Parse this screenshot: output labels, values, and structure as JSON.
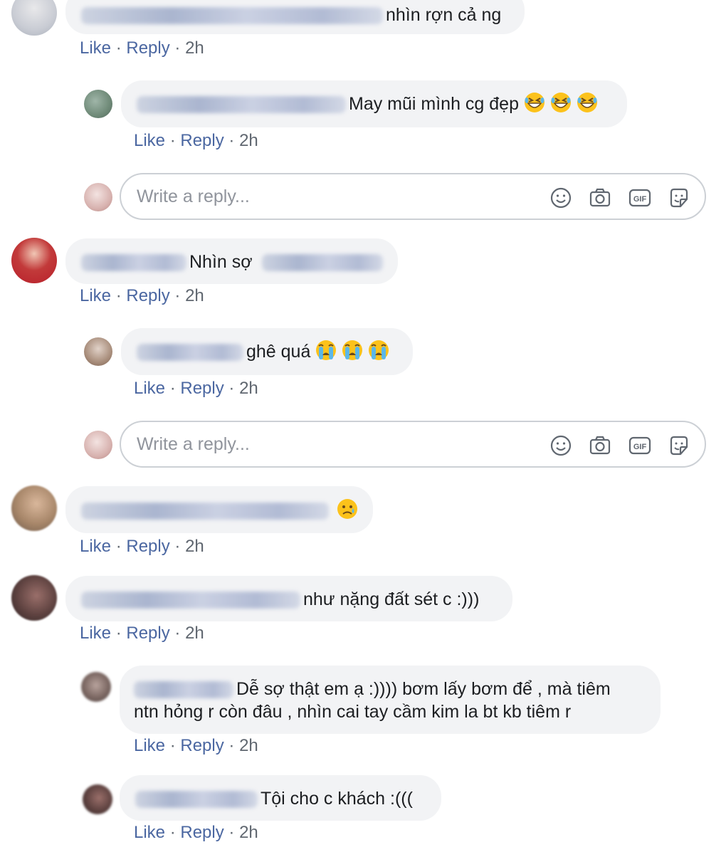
{
  "colors": {
    "bubble_bg": "#f2f3f5",
    "link": "#4b67a1",
    "meta": "#606770",
    "placeholder": "#90949c",
    "input_border": "#ccd0d5"
  },
  "comments": [
    {
      "text": "nhìn rợn cả ng",
      "like": "Like",
      "reply": "Reply",
      "time": "2h"
    },
    {
      "text": "May mũi mình cg đẹp",
      "like": "Like",
      "reply": "Reply",
      "time": "2h",
      "emoji": [
        "grinning-squinting-face"
      ]
    },
    {
      "text": "Nhìn sợ",
      "like": "Like",
      "reply": "Reply",
      "time": "2h"
    },
    {
      "text": "ghê quá",
      "like": "Like",
      "reply": "Reply",
      "time": "2h",
      "emoji": [
        "loudly-crying-face"
      ]
    },
    {
      "text": "",
      "like": "Like",
      "reply": "Reply",
      "time": "2h",
      "emoji": [
        "sad-but-relieved-face"
      ]
    },
    {
      "text": "như nặng đất sét c :)))",
      "like": "Like",
      "reply": "Reply",
      "time": "2h"
    },
    {
      "text_line1": "Dễ sợ thật em ạ :)))) bơm lấy bơm để , mà tiêm",
      "text_line2": "ntn hỏng r còn đâu , nhìn cai tay cầm kim la bt kb tiêm r",
      "like": "Like",
      "reply": "Reply",
      "time": "2h"
    },
    {
      "text": "Tội cho c khách :(((",
      "like": "Like",
      "reply": "Reply",
      "time": "2h"
    }
  ],
  "reply_boxes": [
    {
      "placeholder": "Write a reply...",
      "icons": [
        "smiley-icon",
        "camera-icon",
        "gif-icon",
        "sticker-icon"
      ]
    },
    {
      "placeholder": "Write a reply...",
      "icons": [
        "smiley-icon",
        "camera-icon",
        "gif-icon",
        "sticker-icon"
      ]
    }
  ],
  "separator": "·",
  "gif_label": "GIF"
}
